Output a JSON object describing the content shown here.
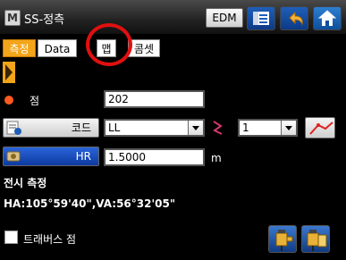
{
  "titlebar": {
    "app_title": "SS-정측",
    "edm_label": "EDM",
    "app_icon_letter": "M",
    "icons": [
      "app-icon",
      "menu-icon",
      "back-arrow-icon",
      "home-icon"
    ]
  },
  "tabs": [
    {
      "label": "측정",
      "active": true
    },
    {
      "label": "Data",
      "active": false
    },
    {
      "label": "맵",
      "active": false
    },
    {
      "label": "콤셋",
      "active": false
    }
  ],
  "form": {
    "point_label": "점",
    "point_value": "202",
    "code_button_label": "코드",
    "code_value": "LL",
    "string_value": "1",
    "hr_button_label": "HR",
    "hr_value": "1.5000",
    "hr_unit": "m"
  },
  "status": {
    "mode_label": "전시 측정",
    "angles": "HA:105°59'40\",VA:56°32'05\""
  },
  "footer": {
    "traverse_label": "트래버스 점",
    "traverse_checked": false
  },
  "colors": {
    "accent_orange": "#f2a51a",
    "highlight_red": "#e01010",
    "button_blue": "#1f5fb8"
  }
}
